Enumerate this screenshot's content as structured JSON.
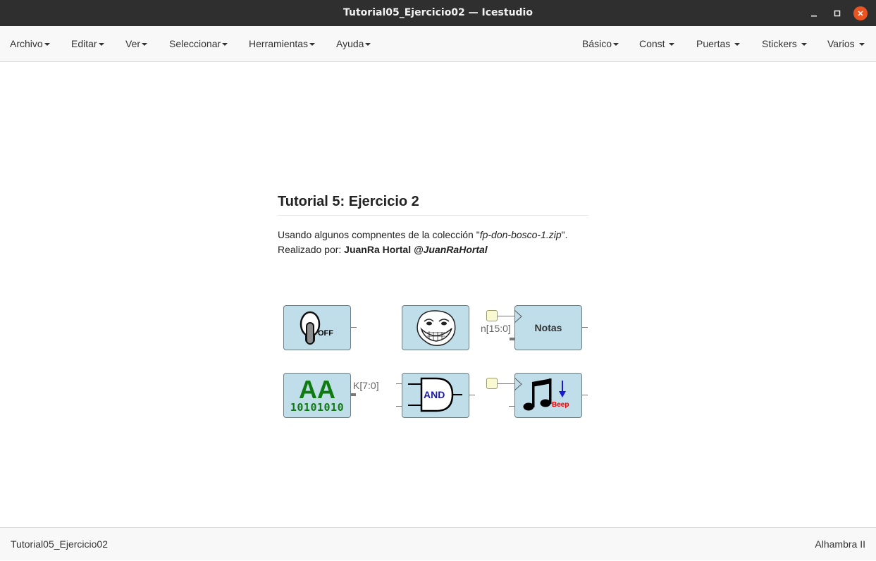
{
  "window": {
    "title": "Tutorial05_Ejercicio02 — Icestudio"
  },
  "menu_left": [
    {
      "label": "Archivo"
    },
    {
      "label": "Editar"
    },
    {
      "label": "Ver"
    },
    {
      "label": "Seleccionar"
    },
    {
      "label": "Herramientas"
    },
    {
      "label": "Ayuda"
    }
  ],
  "menu_right": [
    {
      "label": "Básico"
    },
    {
      "label": "Const"
    },
    {
      "label": "Puertas"
    },
    {
      "label": "Stickers"
    },
    {
      "label": "Varios"
    }
  ],
  "doc": {
    "title": "Tutorial 5: Ejercicio 2",
    "line1_a": "Usando algunos compnentes de la colección \"",
    "line1_em": "fp-don-bosco-1.zip",
    "line1_b": "\".",
    "line2_a": "Realizado por: ",
    "line2_author": "JuanRa Hortal",
    "line2_handle": "@JuanRaHortal"
  },
  "blocks": {
    "switch_label": "OFF",
    "notas_label": "Notas",
    "notas_param": "n[15:0]",
    "const_big": "AA",
    "const_bits": "10101010",
    "const_param": "K[7:0]",
    "and_label": "AND",
    "beep_label": "Beep"
  },
  "status": {
    "left": "Tutorial05_Ejercicio02",
    "right": "Alhambra II"
  },
  "colors": {
    "block_fill": "#bfdeea",
    "param_fill": "#fafad2",
    "titlebar": "#2f2f2f",
    "close_button": "#e95420"
  }
}
